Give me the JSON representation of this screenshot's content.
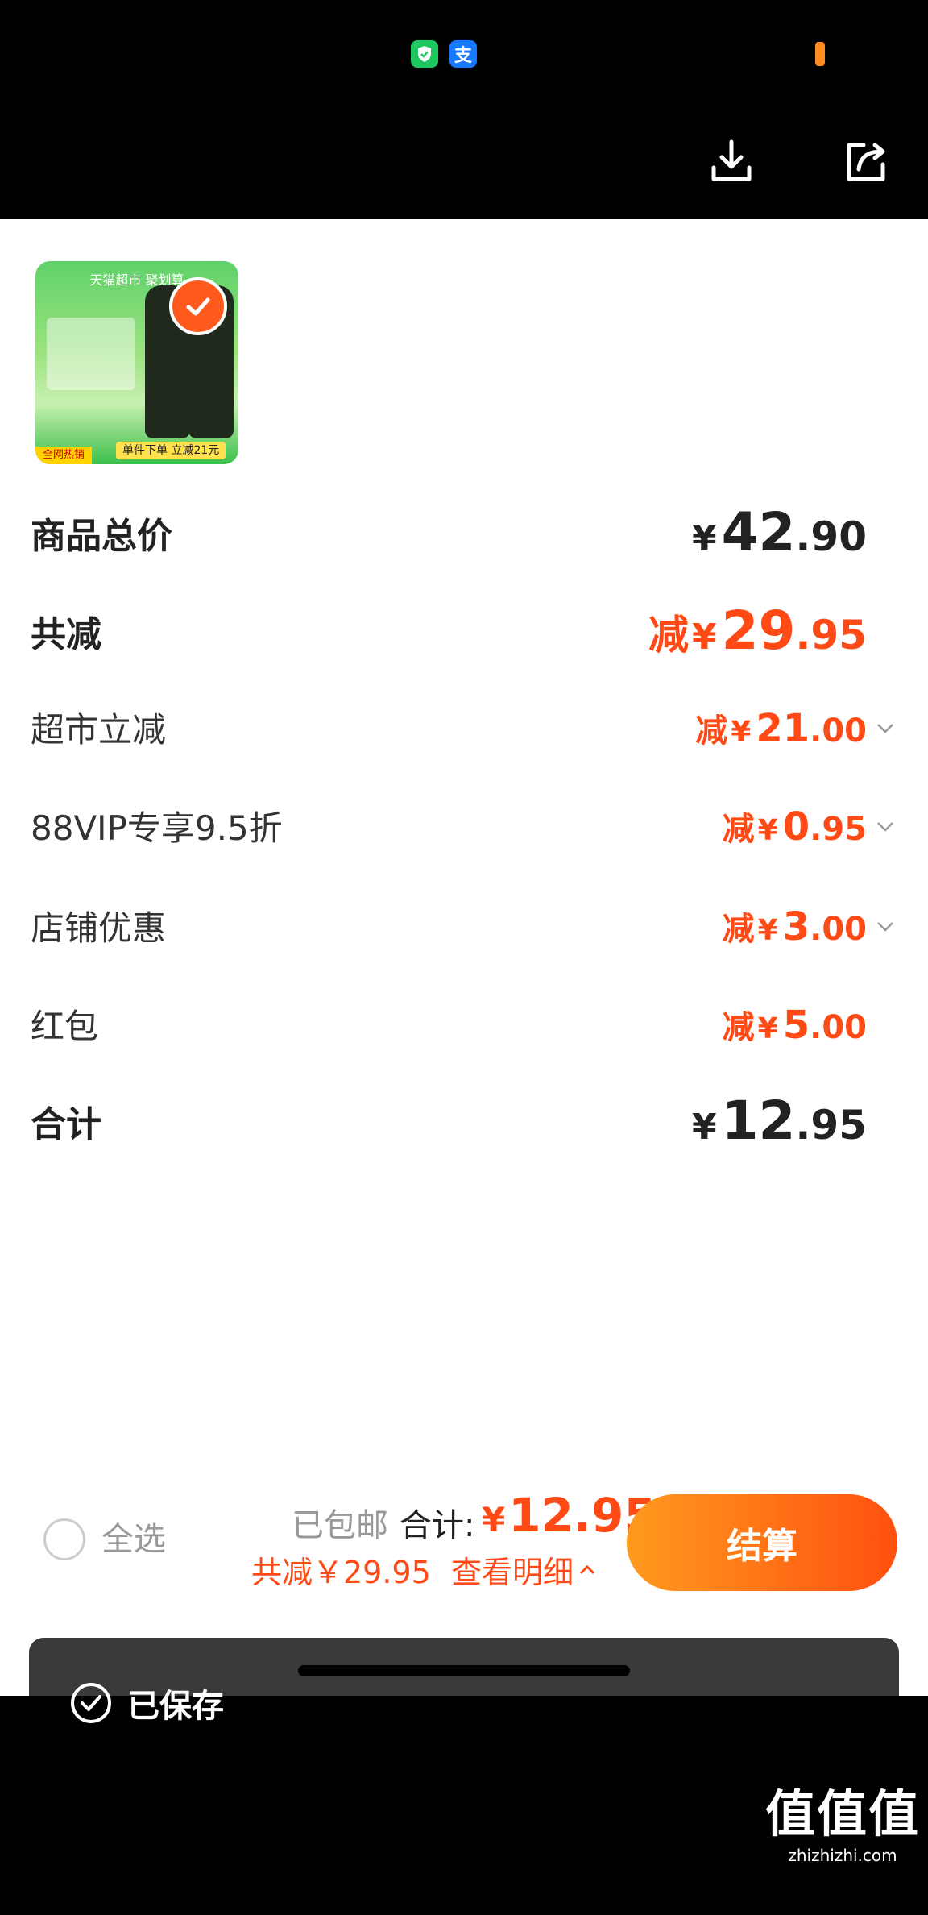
{
  "status_bar": {
    "icons": [
      "shield-icon",
      "alipay-icon"
    ],
    "alipay_char": "支"
  },
  "toolbar": {
    "download_icon": "download-icon",
    "share_icon": "share-icon"
  },
  "product": {
    "badge_top": "天猫超市 聚划算",
    "badge_bottom_left": "全网热销",
    "badge_bottom_right": "单件下单 立减21元",
    "selected": true
  },
  "summary": {
    "goods_total": {
      "label": "商品总价",
      "yen": "¥",
      "int": "42",
      "dec": ".90"
    },
    "total_discount": {
      "label": "共减",
      "prefix": "减",
      "yen": "¥",
      "int": "29",
      "dec": ".95"
    },
    "items": [
      {
        "label": "超市立减",
        "prefix": "减",
        "yen": "¥",
        "int": "21",
        "dec": ".00",
        "expandable": true
      },
      {
        "label": "88VIP专享9.5折",
        "prefix": "减",
        "yen": "¥",
        "int": "0",
        "dec": ".95",
        "expandable": true
      },
      {
        "label": "店铺优惠",
        "prefix": "减",
        "yen": "¥",
        "int": "3",
        "dec": ".00",
        "expandable": true
      },
      {
        "label": "红包",
        "prefix": "减",
        "yen": "¥",
        "int": "5",
        "dec": ".00",
        "expandable": false
      }
    ],
    "grand_total": {
      "label": "合计",
      "yen": "¥",
      "int": "12",
      "dec": ".95"
    }
  },
  "bottom_bar": {
    "select_all": "全选",
    "free_shipping": "已包邮",
    "total_label": "合计:",
    "total_yen": "¥",
    "total_value": "12.95",
    "saved_text": "共减￥29.95",
    "detail_text": "查看明细",
    "checkout": "结算"
  },
  "toast": {
    "text": "已保存"
  },
  "watermark": {
    "big": "值值值",
    "small": "zhizhizhi.com"
  },
  "colors": {
    "accent": "#ff4a16",
    "checkout_start": "#ff9a1e",
    "checkout_end": "#ff5010"
  }
}
